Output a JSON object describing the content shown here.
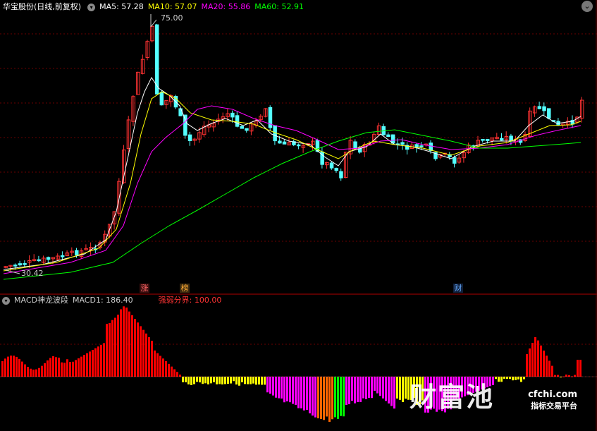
{
  "price_panel": {
    "title": "华宝股份(日线,前复权)",
    "ma5": "MA5: 57.28",
    "ma10": "MA10: 57.07",
    "ma20": "MA20: 55.86",
    "ma60": "MA60: 52.91",
    "high_label": "75.00",
    "low_label": "30.42",
    "marks": [
      "涨",
      "榜",
      "财"
    ]
  },
  "indicator_panel": {
    "name": "MACD神龙波段",
    "macd1": "MACD1: 186.40",
    "threshold": "强弱分界: 100.00"
  },
  "watermark": {
    "brand": "财富池",
    "site": "cfchi.com",
    "slogan": "指标交易平台"
  },
  "colors": {
    "up": "#ff3232",
    "down": "#54ffff",
    "ma5": "#ffffff",
    "ma10": "#ffff00",
    "ma20": "#ff00ff",
    "ma60": "#00ff00",
    "separator": "#b00000",
    "hist_red": "#ff0000",
    "hist_yellow": "#ffff00",
    "hist_magenta": "#ff00ff",
    "hist_orange": "#ff6600",
    "hist_green": "#00ff00"
  },
  "chart_data": [
    {
      "type": "candlestick",
      "title": "华宝股份(日线,前复权)",
      "ylim": [
        30.42,
        75.0
      ],
      "series": [
        {
          "name": "MA5",
          "last": 57.28
        },
        {
          "name": "MA10",
          "last": 57.07
        },
        {
          "name": "MA20",
          "last": 55.86
        },
        {
          "name": "MA60",
          "last": 52.91
        }
      ],
      "annotations": [
        "75.00",
        "30.42"
      ]
    },
    {
      "type": "bar",
      "title": "MACD神龙波段",
      "series": [
        {
          "name": "MACD1",
          "last": 186.4
        }
      ],
      "reference_line": {
        "name": "强弱分界",
        "value": 100.0
      }
    }
  ]
}
